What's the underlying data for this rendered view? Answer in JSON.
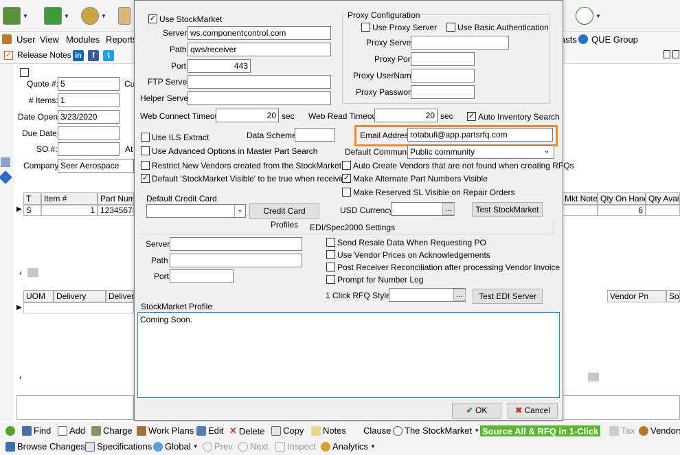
{
  "menu": {
    "user": "User",
    "view": "View",
    "modules": "Modules",
    "reports": "Reports",
    "posts_partial": "asts",
    "que_group": "QUE Group"
  },
  "row2": {
    "release_notes": "Release Notes",
    "linkedin": "in",
    "facebook": "f",
    "twitter": "t"
  },
  "left_form": {
    "quote_label": "Quote #:",
    "quote_value": "5",
    "cu_label": "Cu",
    "items_label": "# Items:",
    "items_value": "1",
    "date_open_label": "Date Open:",
    "date_open_value": "3/23/2020",
    "due_date_label": "Due Date:",
    "so_label": "SO #:",
    "at_label": "At",
    "company_label": "Company:",
    "company_value": "Seer Aerospace"
  },
  "grid1": {
    "headers": [
      "T",
      "Item #",
      "Part Numb"
    ],
    "row": [
      "S",
      "1",
      "12345678"
    ],
    "right_headers": [
      "Mkt Notes",
      "Qty On Hand",
      "Qty Availa"
    ],
    "qty_on_hand": "6"
  },
  "grid2": {
    "headers": [
      "UOM",
      "Delivery",
      "Delivery"
    ],
    "right_headers": [
      "Vendor Pn",
      "Sou"
    ]
  },
  "dialog": {
    "use_stockmarket": "Use StockMarket",
    "server_label": "Server",
    "server_value": "ws.componentcontrol.com",
    "path_label": "Path",
    "path_value": "qws/receiver",
    "port_label": "Port",
    "port_value": "443",
    "ftp_label": "FTP Server",
    "helper_label": "Helper Server",
    "web_connect_label": "Web Connect Timeout",
    "web_connect_value": "20",
    "sec1": "sec",
    "web_read_label": "Web Read Timeout",
    "web_read_value": "20",
    "sec2": "sec",
    "auto_inventory": "Auto Inventory Search",
    "proxy_title": "Proxy Configuration",
    "use_proxy": "Use Proxy Server",
    "use_basic_auth": "Use Basic Authentication",
    "proxy_server_label": "Proxy Server",
    "proxy_port_label": "Proxy Port",
    "proxy_user_label": "Proxy UserName",
    "proxy_password_label": "Proxy Password",
    "use_ils": "Use ILS Extract",
    "data_scheme": "Data Scheme",
    "email_label": "Email Address",
    "email_value": "rotabull@app.partsrfq.com",
    "use_advanced": "Use Advanced Options in Master Part Search",
    "default_community_label": "Default Community",
    "default_community_value": "Public community",
    "restrict_vendors": "Restrict New Vendors created from the StockMarket",
    "auto_create": "Auto Create Vendors that are not found when creating RFQs",
    "default_visible": "Default 'StockMarket Visible' to be true when receiving",
    "alternate_visible": "Make Alternate Part Numbers Visible",
    "reserved_visible": "Make Reserved SL Visible on Repair Orders",
    "credit_card_label": "Default Credit Card",
    "credit_card_profiles": "Credit Card Profiles",
    "usd_currency": "USD Currency",
    "ellipsis": "...",
    "test_stockmarket": "Test StockMarket",
    "edi_title": "EDI/Spec2000 Settings",
    "edi_server": "Server",
    "edi_path": "Path",
    "edi_port": "Port",
    "send_resale": "Send Resale Data When Requesting PO",
    "use_vendor_prices": "Use Vendor Prices on Acknowledgements",
    "post_receiver": "Post Receiver Reconciliation after processing Vendor Invoice",
    "prompt_number": "Prompt for Number Log",
    "one_click_label": "1 Click RFQ Style:",
    "test_edi": "Test EDI Server",
    "profile_label": "StockMarket Profile",
    "profile_value": "Coming Soon.",
    "ok": "OK",
    "cancel": "Cancel"
  },
  "bottom1": {
    "find": "Find",
    "add": "Add",
    "charge": "Charge",
    "work_plans": "Work Plans",
    "edit": "Edit",
    "delete": "Delete",
    "copy": "Copy",
    "notes": "Notes",
    "clause": "Clause",
    "stockmarket": "The StockMarket",
    "source_all": "Source All & RFQ in 1-Click",
    "tax": "Tax",
    "vendors": "Vendors"
  },
  "bottom2": {
    "browse": "Browse Changes",
    "specs": "Specifications",
    "global": "Global",
    "prev": "Prev",
    "next": "Next",
    "inspect": "Inspect",
    "analytics": "Analytics"
  },
  "colors": {
    "highlight": "#ee8a2c",
    "accent_green": "#5cb531"
  }
}
